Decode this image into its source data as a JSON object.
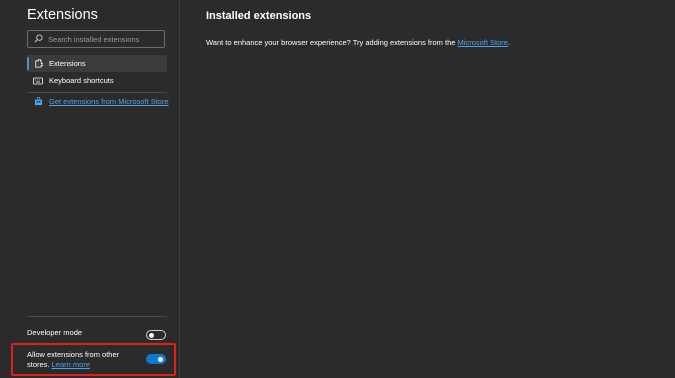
{
  "sidebar": {
    "title": "Extensions",
    "search": {
      "placeholder": "Search installed extensions",
      "value": ""
    },
    "items": [
      {
        "label": "Extensions",
        "icon": "extensions-icon",
        "active": true
      },
      {
        "label": "Keyboard shortcuts",
        "icon": "keyboard-icon",
        "active": false
      }
    ],
    "store_link": {
      "label": "Get extensions from Microsoft Store",
      "icon": "store-bag-icon"
    },
    "developer_mode": {
      "label": "Developer mode",
      "enabled": false
    },
    "allow_other_stores": {
      "label": "Allow extensions from other stores.",
      "learn_more": "Learn more",
      "enabled": true
    }
  },
  "main": {
    "title": "Installed extensions",
    "prompt_text": "Want to enhance your browser experience? Try adding extensions from the ",
    "prompt_link": "Microsoft Store",
    "prompt_end": "."
  },
  "colors": {
    "background": "#2b2b2b",
    "accent": "#0f78d4",
    "link": "#4fa3e8",
    "highlight": "#e0201a"
  }
}
